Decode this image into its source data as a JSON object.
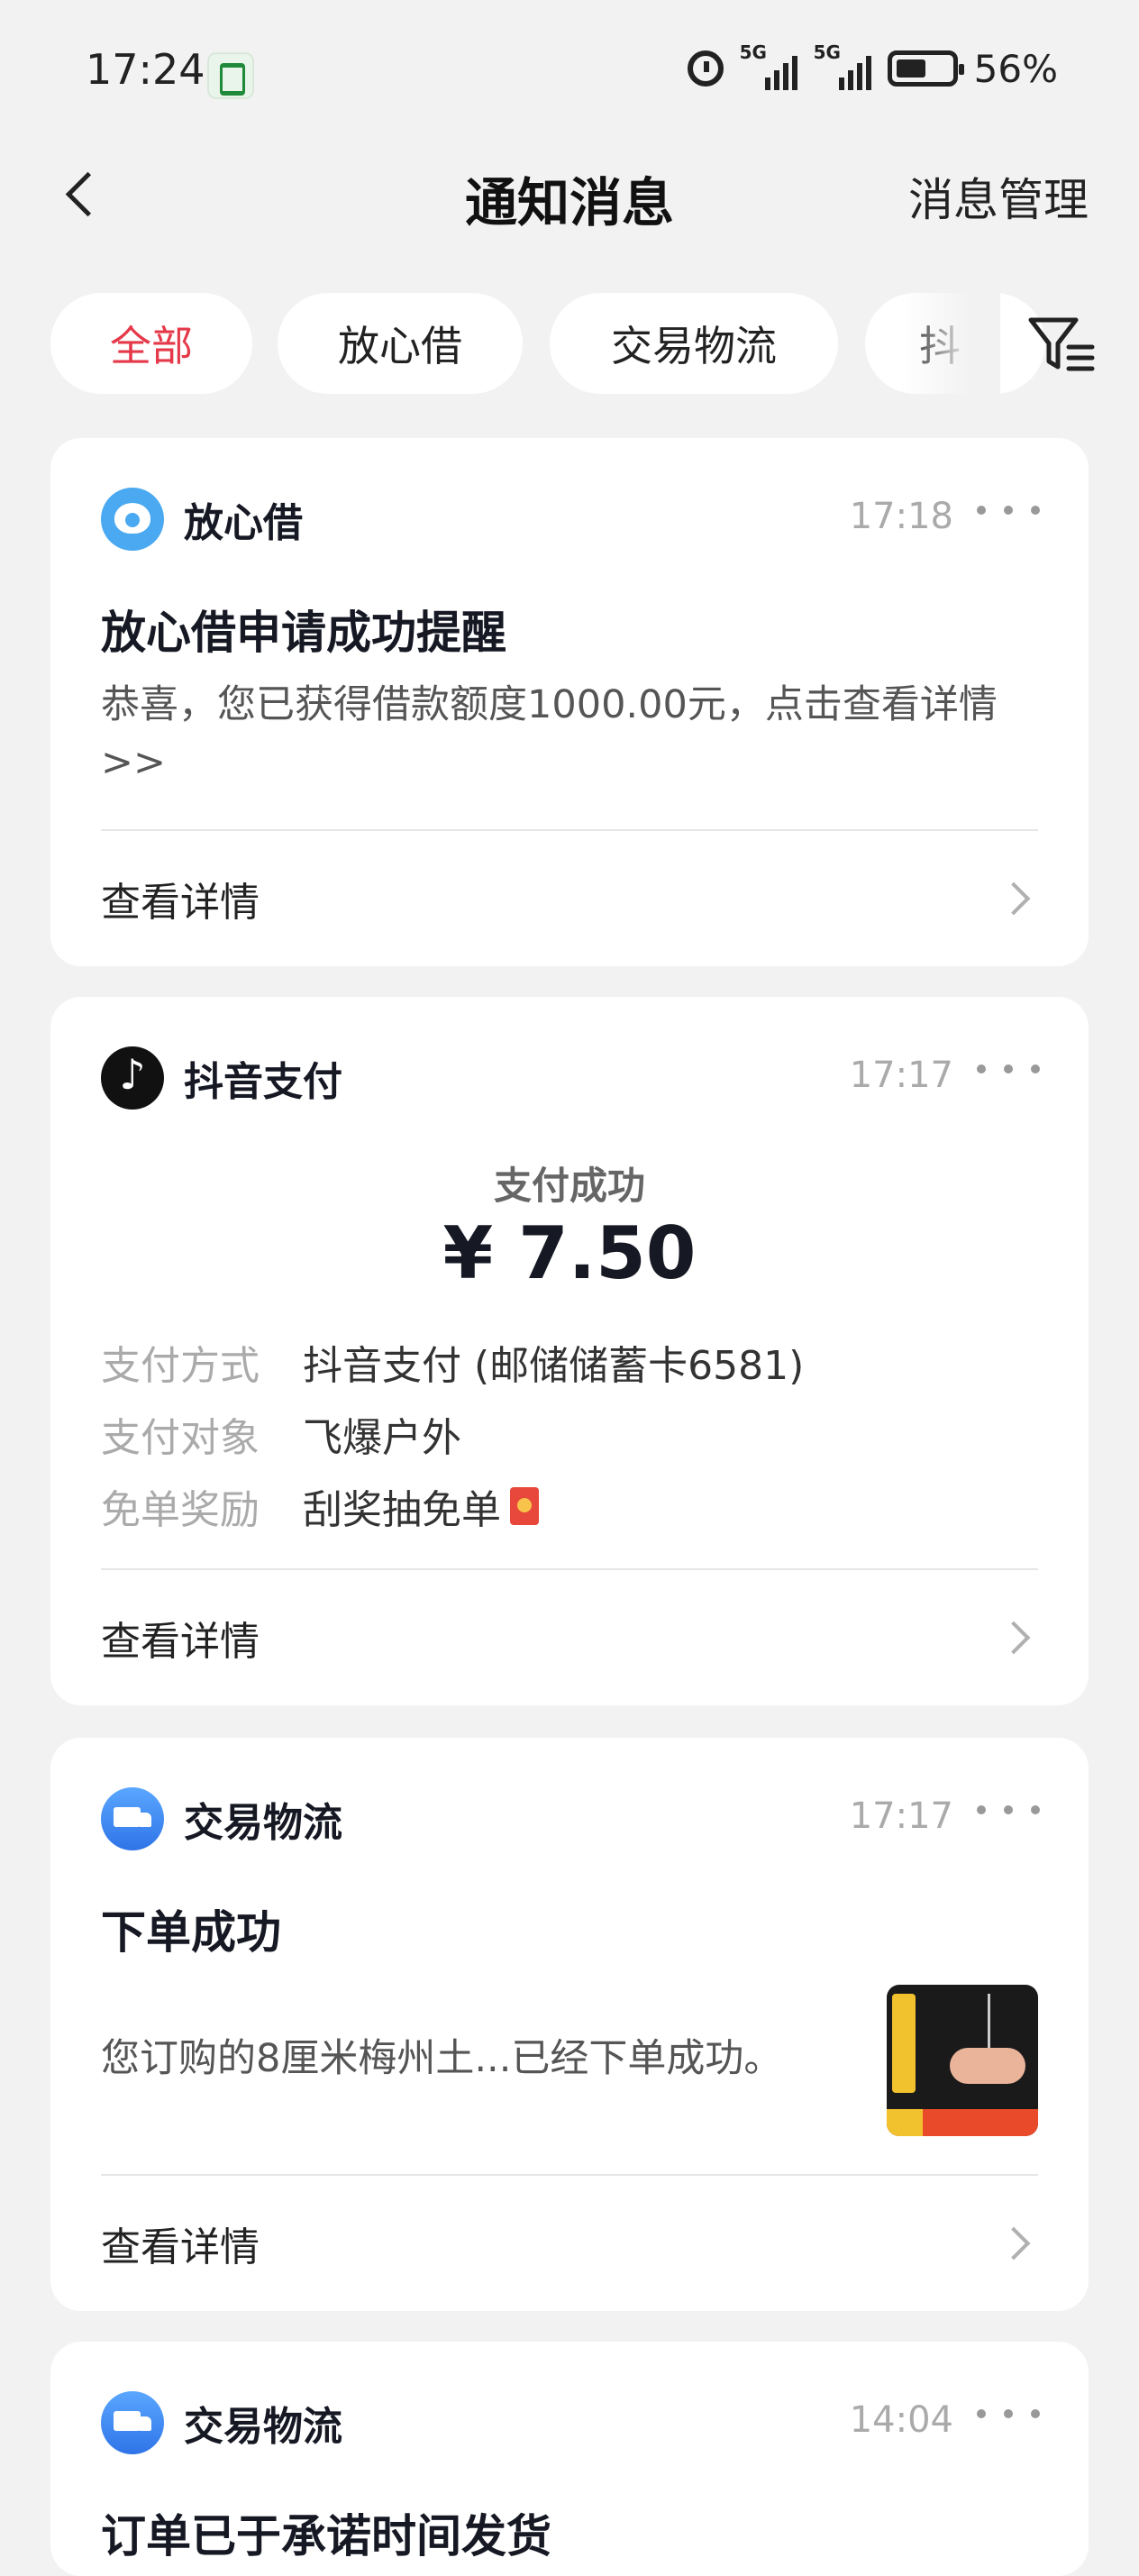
{
  "status_bar": {
    "time": "17:24",
    "battery_text": "56%",
    "signal1": "5G",
    "signal2": "5G"
  },
  "header": {
    "title": "通知消息",
    "manage_label": "消息管理"
  },
  "tabs": [
    {
      "label": "全部",
      "active": true
    },
    {
      "label": "放心借",
      "active": false
    },
    {
      "label": "交易物流",
      "active": false
    },
    {
      "label": "抖",
      "active": false
    }
  ],
  "cards": [
    {
      "source": "放心借",
      "time": "17:18",
      "title": "放心借申请成功提醒",
      "body": "恭喜，您已获得借款额度1000.00元，点击查看详情>>",
      "detail_label": "查看详情"
    },
    {
      "source": "抖音支付",
      "time": "17:17",
      "status": "支付成功",
      "amount": "¥ 7.50",
      "fields": [
        {
          "key": "支付方式",
          "value": "抖音支付 (邮储储蓄卡6581)"
        },
        {
          "key": "支付对象",
          "value": "飞爆户外"
        },
        {
          "key": "免单奖励",
          "value": "刮奖抽免单"
        }
      ],
      "detail_label": "查看详情"
    },
    {
      "source": "交易物流",
      "time": "17:17",
      "title": "下单成功",
      "body": "您订购的8厘米梅州土...已经下单成功。",
      "detail_label": "查看详情"
    },
    {
      "source": "交易物流",
      "time": "14:04",
      "title": "订单已于承诺时间发货"
    }
  ]
}
